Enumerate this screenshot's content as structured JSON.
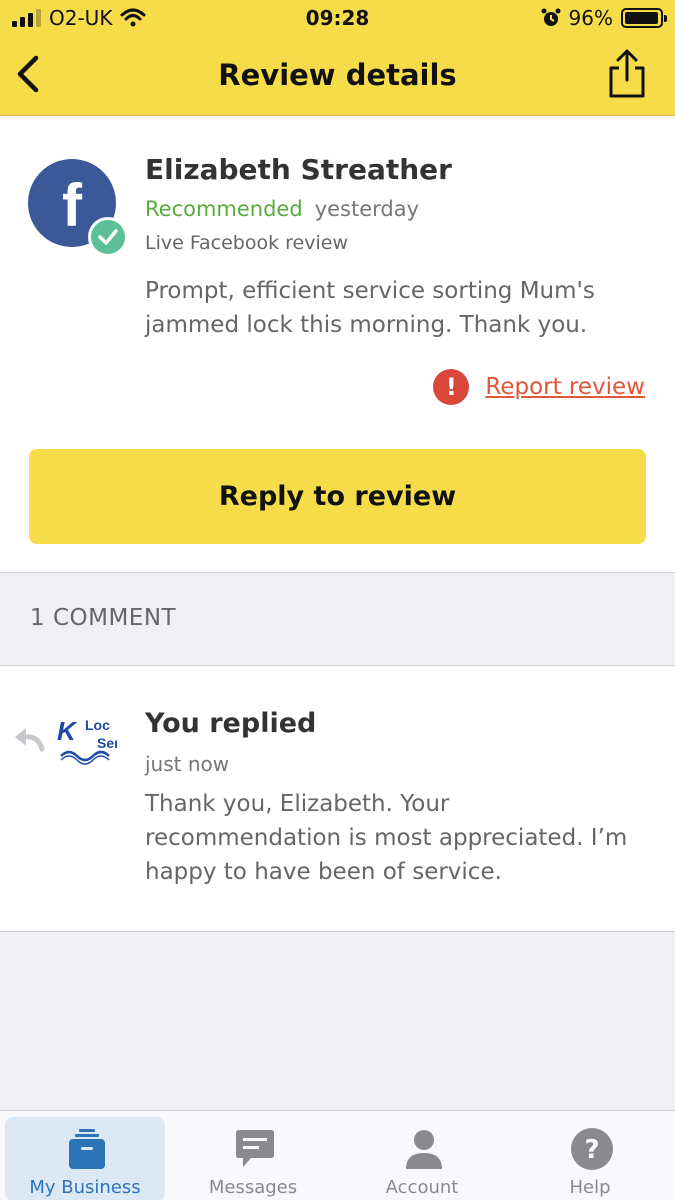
{
  "status_bar": {
    "carrier": "O2-UK",
    "time": "09:28",
    "battery": "96%",
    "battery_level": 0.96
  },
  "header": {
    "title": "Review details"
  },
  "review": {
    "reviewer_name": "Elizabeth Streather",
    "recommendation": "Recommended",
    "when": "yesterday",
    "source": "Live Facebook review",
    "text": "Prompt, efficient service sorting Mum's jammed lock this morning. Thank you.",
    "report_label": "Report review",
    "reply_button": "Reply to review"
  },
  "comments": {
    "count_label": "1 COMMENT",
    "items": [
      {
        "author_label": "You replied",
        "logo_text": [
          "K",
          "Loc",
          "Ser"
        ],
        "time": "just now",
        "text": "Thank you, Elizabeth. Your recommendation is most appreciated. I’m happy to have been of service."
      }
    ]
  },
  "tabbar": {
    "tabs": [
      {
        "label": "My Business",
        "icon": "briefcase-icon",
        "active": true
      },
      {
        "label": "Messages",
        "icon": "chat-icon",
        "active": false
      },
      {
        "label": "Account",
        "icon": "person-icon",
        "active": false
      },
      {
        "label": "Help",
        "icon": "help-icon",
        "active": false
      }
    ]
  },
  "colors": {
    "brand_yellow": "#f7dc4a",
    "recommended_green": "#5aab3c",
    "report_red": "#e2573a",
    "facebook_blue": "#3b5998",
    "tab_active_blue": "#2b74b8"
  }
}
